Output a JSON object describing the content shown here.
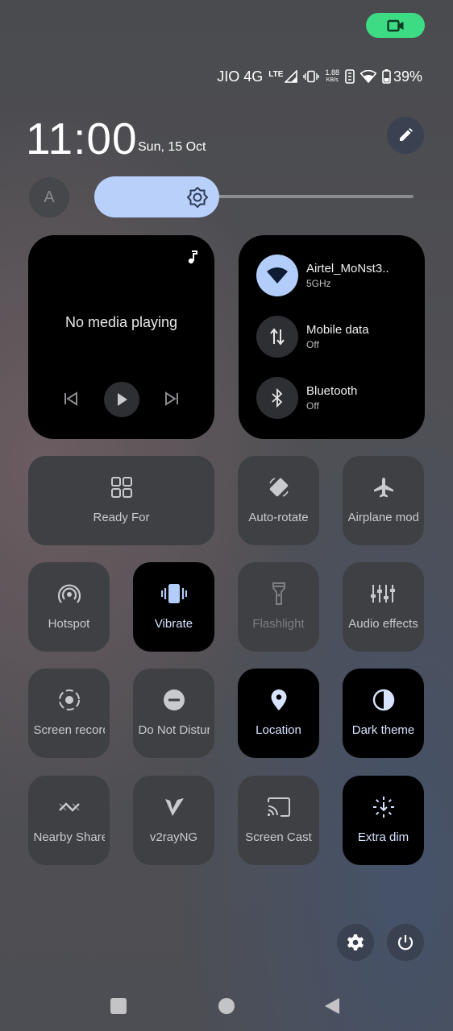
{
  "status_bar": {
    "carrier": "JIO 4G",
    "lte": "LTE",
    "speed_value": "1.88",
    "speed_unit": "KB/s",
    "battery": "39%"
  },
  "header": {
    "time": "11:00",
    "date": "Sun, 15 Oct"
  },
  "brightness": {
    "auto_label": "A",
    "level": 0.3
  },
  "media": {
    "message": "No media playing"
  },
  "network": {
    "wifi": {
      "name": "Airtel_MoNst3..",
      "status": "5GHz"
    },
    "mobile_data": {
      "name": "Mobile data",
      "status": "Off"
    },
    "bluetooth": {
      "name": "Bluetooth",
      "status": "Off"
    }
  },
  "tiles": {
    "ready_for": "Ready For",
    "auto_rotate": "Auto-rotate",
    "airplane": "Airplane mode",
    "hotspot": "Hotspot",
    "vibrate": "Vibrate",
    "flashlight": "Flashlight",
    "audio_effects": "Audio effects",
    "screen_record": "Screen record",
    "do_not_disturb": "Do Not Disturb",
    "location": "Location",
    "dark_theme": "Dark theme",
    "nearby_share": "Nearby Share",
    "v2rayng": "v2rayNG",
    "screen_cast": "Screen Cast",
    "extra_dim": "Extra dim"
  },
  "colors": {
    "accent": "#b9d0fb",
    "camera_indicator": "#3ddc84",
    "tile_active": "#000000",
    "tile_inactive": "#3e4044"
  }
}
